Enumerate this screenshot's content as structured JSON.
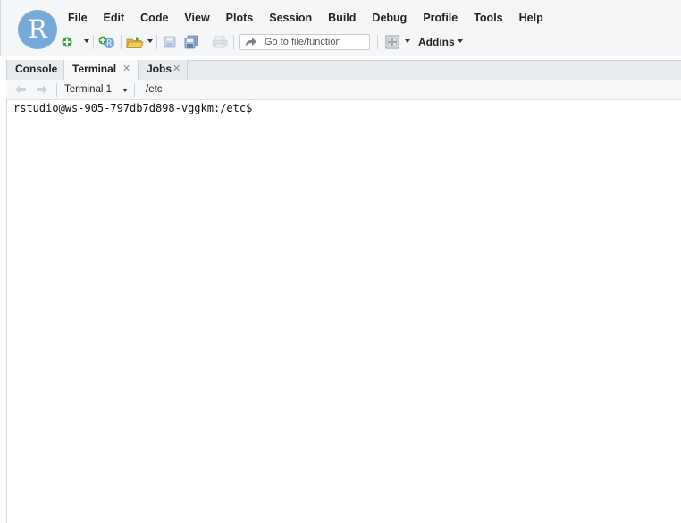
{
  "app": {
    "logo_letter": "R"
  },
  "menu": [
    "File",
    "Edit",
    "Code",
    "View",
    "Plots",
    "Session",
    "Build",
    "Debug",
    "Profile",
    "Tools",
    "Help"
  ],
  "toolbar": {
    "goto_placeholder": "Go to file/function",
    "addins_label": "Addins",
    "icons": [
      "new-file-icon",
      "new-project-icon",
      "open-folder-icon",
      "save-icon",
      "save-all-icon",
      "print-icon",
      "grid-layout-icon"
    ]
  },
  "tabs": [
    {
      "label": "Console",
      "closable": false,
      "active": false
    },
    {
      "label": "Terminal",
      "closable": true,
      "active": true
    },
    {
      "label": "Jobs",
      "closable": true,
      "active": false
    }
  ],
  "terminal": {
    "selector_label": "Terminal 1",
    "current_dir": "/etc",
    "prompt": "rstudio@ws-905-797db7d898-vggkm:/etc$ "
  },
  "colors": {
    "accent": "#75aadb",
    "green": "#3fa53f"
  }
}
